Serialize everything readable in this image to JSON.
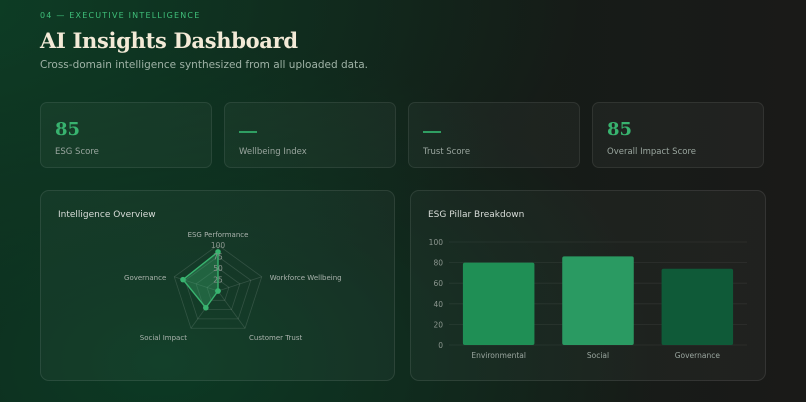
{
  "header": {
    "eyebrow": "04 — EXECUTIVE INTELLIGENCE",
    "title": "AI Insights Dashboard",
    "subtitle": "Cross-domain intelligence synthesized from all uploaded data."
  },
  "kpis": [
    {
      "value": "85",
      "label": "ESG Score",
      "empty": false
    },
    {
      "value": "—",
      "label": "Wellbeing Index",
      "empty": true
    },
    {
      "value": "—",
      "label": "Trust Score",
      "empty": true
    },
    {
      "value": "85",
      "label": "Overall Impact Score",
      "empty": false
    }
  ],
  "colors": {
    "accent": "#38b36f",
    "bar1": "#1f8f55",
    "bar2": "#2a9a62",
    "bar3": "#0f5a38"
  },
  "radar": {
    "title": "Intelligence Overview",
    "axes": [
      "ESG Performance",
      "Workforce Wellbeing",
      "Customer Trust",
      "Social Impact",
      "Governance"
    ],
    "ticks": [
      "100",
      "75",
      "50",
      "25"
    ],
    "values": [
      85,
      0,
      0,
      45,
      80
    ],
    "max": 100
  },
  "chart_data": {
    "type": "bar",
    "title": "ESG Pillar Breakdown",
    "categories": [
      "Environmental",
      "Social",
      "Governance"
    ],
    "values": [
      80,
      86,
      74
    ],
    "ylim": [
      0,
      100
    ],
    "yticks": [
      0,
      20,
      40,
      60,
      80,
      100
    ],
    "grid": true
  }
}
